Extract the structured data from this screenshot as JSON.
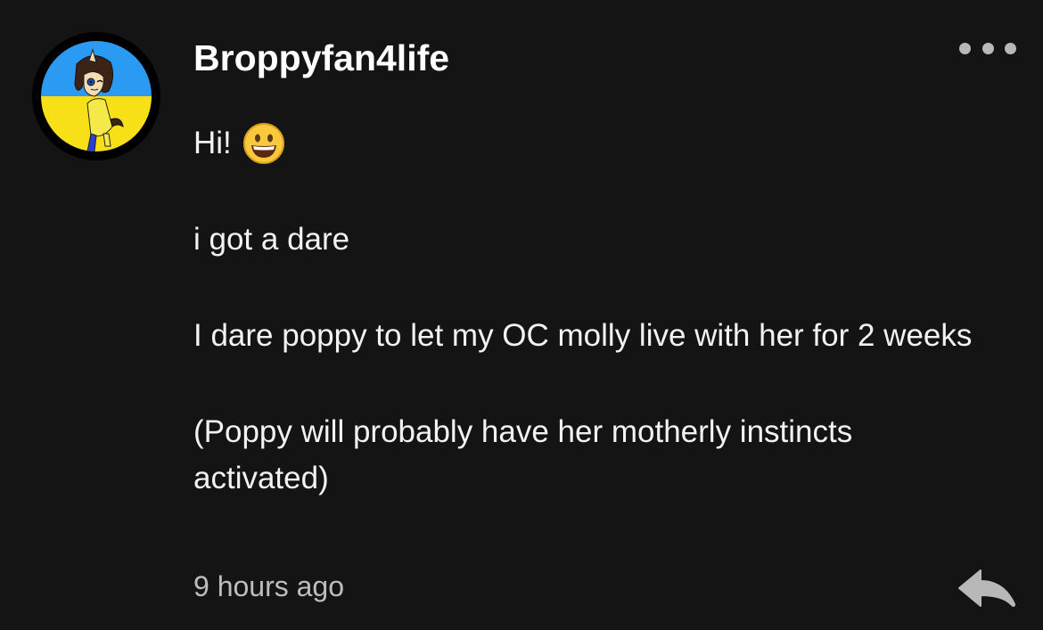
{
  "comment": {
    "username": "Broppyfan4life",
    "avatar": {
      "colors": {
        "top": "#2a9af2",
        "bottom": "#f7e017",
        "ring": "#000000"
      }
    },
    "more_icon": "more-horizontal-icon",
    "paragraphs": {
      "p1": "Hi!",
      "p1_emoji": "grinning-face-emoji",
      "p2": "i got a dare",
      "p3": "I dare poppy to let my OC molly live with her for 2 weeks",
      "p4": "(Poppy will probably have her motherly instincts activated)"
    },
    "timestamp": "9 hours ago",
    "reply_icon": "reply-arrow-icon"
  },
  "theme": {
    "background": "#141414",
    "text": "#f2f2f2",
    "muted": "#bdbdbd",
    "icon": "#b8b8b8"
  }
}
